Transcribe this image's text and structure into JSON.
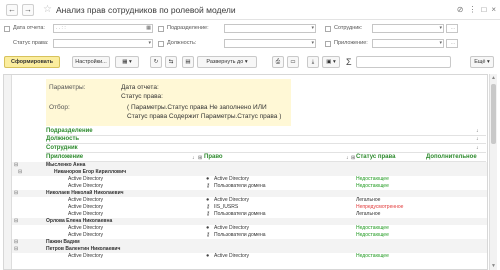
{
  "window": {
    "title": "Анализ прав сотрудников по ролевой модели",
    "back": "←",
    "forward": "→",
    "star": "☆",
    "icons": {
      "link": "🔗",
      "more": "⋮",
      "maximize": "□",
      "close": "×"
    }
  },
  "filters": {
    "date_label": "Дата отчета:",
    "date_value": "",
    "date_placeholder": "  .  .        :  :  ",
    "status_label": "Статус права:",
    "division_label": "Подразделение:",
    "position_label": "Должность:",
    "employee_label": "Сотрудник:",
    "app_label": "Приложение:",
    "dd": "▾",
    "dots": "..."
  },
  "toolbar": {
    "generate": "Сформировать",
    "settings": "Настройки...",
    "variant_icon": "▦",
    "expand_all": "Развернуть до",
    "sum": "Σ",
    "more": "Ещё",
    "dd": "▾"
  },
  "report": {
    "params_label": "Параметры:",
    "params_date": "Дата отчета:",
    "params_status": "Статус права:",
    "filter_label": "Отбор:",
    "filter_line1": "( Параметры.Статус права Не заполнено ИЛИ",
    "filter_line2": "Статус права Содержит Параметры.Статус права )",
    "group_division": "Подразделение",
    "group_position": "Должность",
    "group_employee": "Сотрудник",
    "col_app": "Приложение",
    "col_right": "Право",
    "col_status": "Статус права",
    "col_extra": "Дополнительное",
    "rows": [
      {
        "level": 1,
        "app": "Мысленко Анна",
        "right": "",
        "status": "",
        "kind": "person"
      },
      {
        "level": 2,
        "app": "Никаноров Егор Кириллович",
        "right": "",
        "status": "",
        "kind": "person"
      },
      {
        "level": 3,
        "app": "Active Directory",
        "right": "Active Directory",
        "status": "Недостающее",
        "kind": "right",
        "color": "green",
        "icon": "person"
      },
      {
        "level": 3,
        "app": "Active Directory",
        "right": "Пользователи домена",
        "status": "Недостающее",
        "kind": "right",
        "color": "green",
        "icon": "key"
      },
      {
        "level": 1,
        "app": "Николаев Николай Николаевич",
        "right": "",
        "status": "",
        "kind": "person"
      },
      {
        "level": 3,
        "app": "Active Directory",
        "right": "Active Directory",
        "status": "Легальное",
        "kind": "right",
        "color": "",
        "icon": "person"
      },
      {
        "level": 3,
        "app": "Active Directory",
        "right": "IIS_IUSRS",
        "status": "Непредусмотренное",
        "kind": "right",
        "color": "red",
        "icon": "key"
      },
      {
        "level": 3,
        "app": "Active Directory",
        "right": "Пользователи домена",
        "status": "Легальное",
        "kind": "right",
        "color": "",
        "icon": "key"
      },
      {
        "level": 1,
        "app": "Орлова Елена Николаевна",
        "right": "",
        "status": "",
        "kind": "person"
      },
      {
        "level": 3,
        "app": "Active Directory",
        "right": "Active Directory",
        "status": "Недостающее",
        "kind": "right",
        "color": "green",
        "icon": "person"
      },
      {
        "level": 3,
        "app": "Active Directory",
        "right": "Пользователи домена",
        "status": "Недостающее",
        "kind": "right",
        "color": "green",
        "icon": "key"
      },
      {
        "level": 1,
        "app": "Пажин Вадим",
        "right": "",
        "status": "",
        "kind": "person"
      },
      {
        "level": 1,
        "app": "Петров Валентин Николаевич",
        "right": "",
        "status": "",
        "kind": "person"
      },
      {
        "level": 3,
        "app": "Active Directory",
        "right": "Active Directory",
        "status": "Недостающее",
        "kind": "right",
        "color": "green",
        "icon": "person"
      }
    ]
  },
  "icons": {
    "person": "👤",
    "key": "🔑",
    "tree": "⊟",
    "sort": "↓",
    "filter": "⧩"
  }
}
